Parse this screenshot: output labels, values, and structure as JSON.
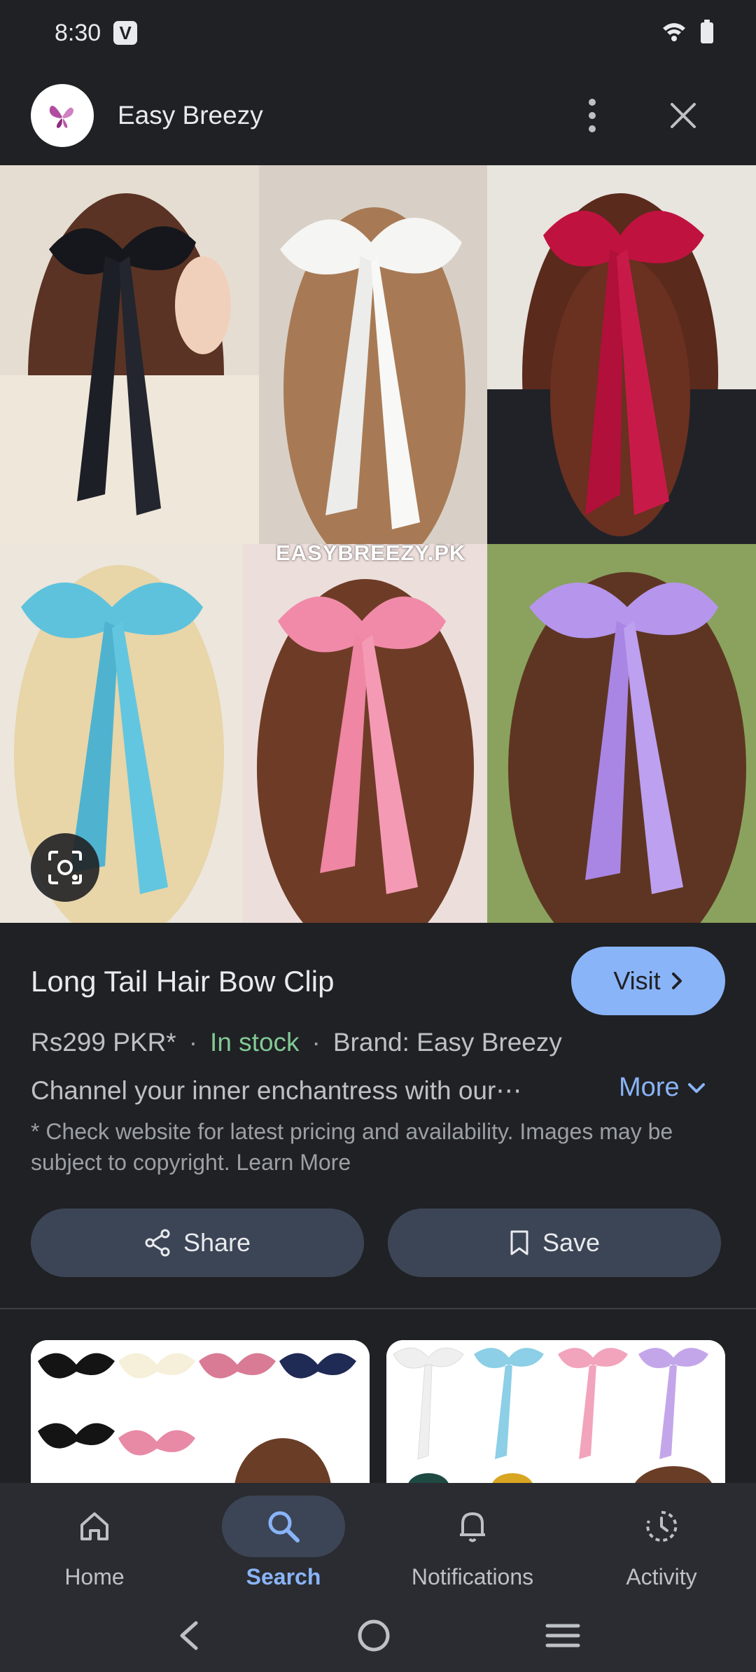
{
  "status_bar": {
    "time": "8:30",
    "badge": "V"
  },
  "header": {
    "title": "Easy Breezy"
  },
  "image": {
    "watermark": "EASYBREEZY.PK"
  },
  "product": {
    "title": "Long Tail Hair Bow Clip",
    "visit_label": "Visit",
    "price": "Rs299 PKR*",
    "dot1": "·",
    "availability": "In stock",
    "dot2": "·",
    "brand": "Brand: Easy Breezy",
    "description": "Channel your inner enchantress with our⋯",
    "more_label": "More",
    "disclaimer": "* Check website for latest pricing and availability. Images may be subject to copyright. Learn More",
    "share_label": "Share",
    "save_label": "Save"
  },
  "bottom_nav": {
    "items": [
      {
        "label": "Home",
        "icon": "home-icon"
      },
      {
        "label": "Search",
        "icon": "search-icon",
        "active": true
      },
      {
        "label": "Notifications",
        "icon": "bell-icon"
      },
      {
        "label": "Activity",
        "icon": "activity-icon"
      }
    ]
  },
  "colors": {
    "accent": "#8ab4f8",
    "in_stock": "#81c995",
    "background": "#202124"
  }
}
